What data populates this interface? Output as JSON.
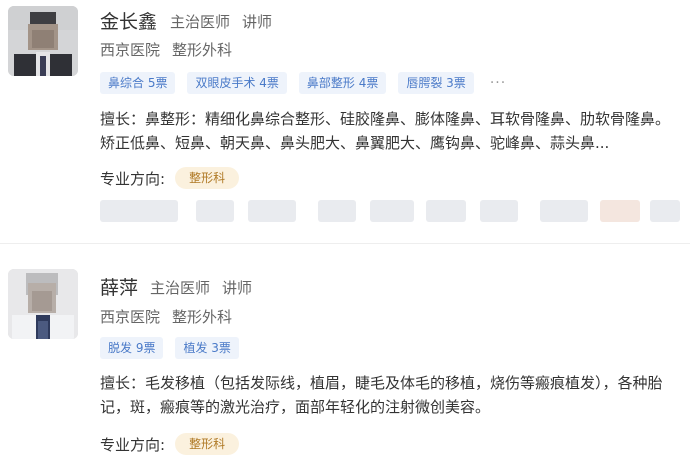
{
  "doctors": [
    {
      "name": "金长鑫",
      "titles": [
        "主治医师",
        "讲师"
      ],
      "hospital": "西京医院",
      "department": "整形外科",
      "tags": [
        "鼻综合 5票",
        "双眼皮手术 4票",
        "鼻部整形 4票",
        "唇腭裂 3票"
      ],
      "more": "···",
      "expertise": "擅长：鼻整形：精细化鼻综合整形、硅胶隆鼻、膨体隆鼻、耳软骨隆鼻、肋软骨隆鼻。矫正低鼻、短鼻、朝天鼻、鼻头肥大、鼻翼肥大、鹰钩鼻、驼峰鼻、蒜头鼻...",
      "direction_label": "专业方向:",
      "direction": "整形科"
    },
    {
      "name": "薛萍",
      "titles": [
        "主治医师",
        "讲师"
      ],
      "hospital": "西京医院",
      "department": "整形外科",
      "tags": [
        "脱发 9票",
        "植发 3票"
      ],
      "expertise": "擅长：毛发移植（包括发际线，植眉，睫毛及体毛的移植，烧伤等瘢痕植发），各种胎记，斑，瘢痕等的激光治疗，面部年轻化的注射微创美容。",
      "direction_label": "专业方向:",
      "direction": "整形科"
    }
  ]
}
